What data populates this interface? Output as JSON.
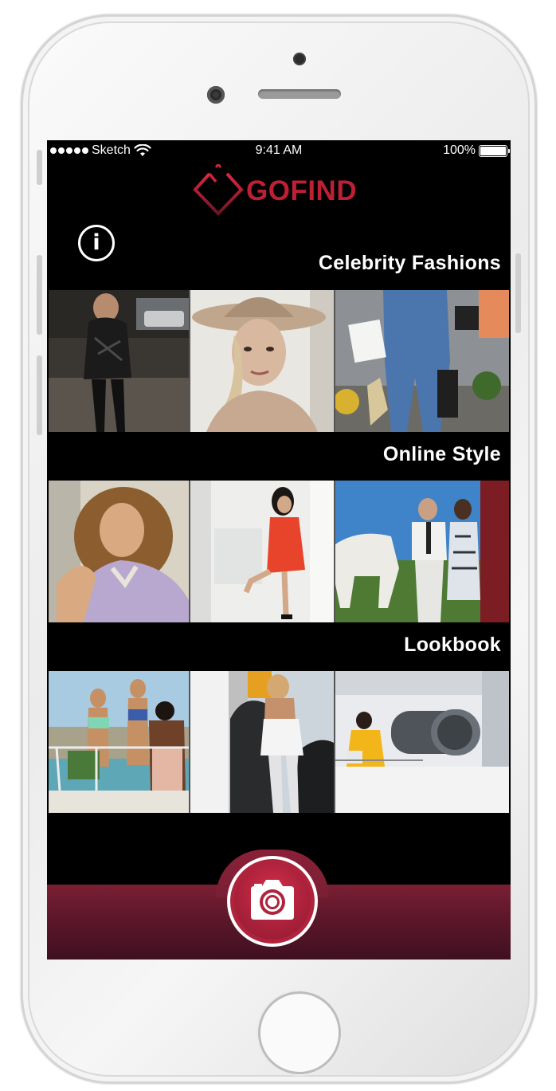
{
  "status_bar": {
    "carrier": "Sketch",
    "time": "9:41 AM",
    "battery": "100%"
  },
  "app": {
    "logo_text": "GOFIND",
    "brand_color": "#bf1f34",
    "bar_color": "#5a1629"
  },
  "icons": {
    "info": "info-icon",
    "camera": "camera-icon",
    "wifi": "wifi-icon",
    "battery": "battery-icon"
  },
  "info_glyph": "i",
  "sections": [
    {
      "title": "Celebrity Fashions",
      "tiles": [
        "photo-1",
        "photo-2",
        "photo-3"
      ]
    },
    {
      "title": "Online Style",
      "tiles": [
        "photo-4",
        "photo-5",
        "photo-6"
      ]
    },
    {
      "title": "Lookbook",
      "tiles": [
        "photo-7",
        "photo-8",
        "photo-9"
      ]
    }
  ]
}
